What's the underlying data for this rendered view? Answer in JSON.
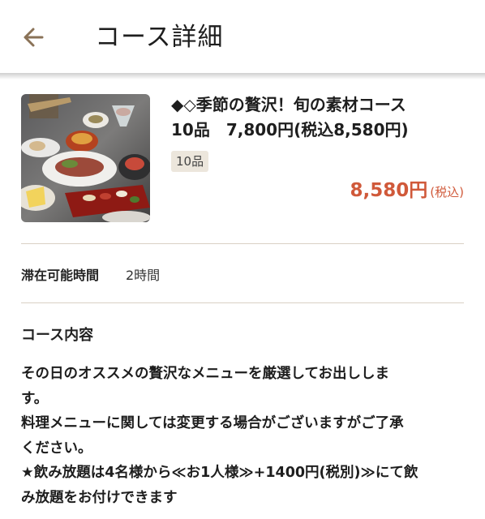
{
  "header": {
    "title": "コース詳細",
    "back_icon": "arrow-left-icon",
    "back_icon_color": "#8a7257"
  },
  "course": {
    "name_lines": [
      "◆◇季節の贅沢！旬の素材コース",
      "10品　7,800円(税込8,580円)"
    ],
    "item_count_badge": "10品",
    "price": "8,580円",
    "price_tax_note": "(税込)",
    "price_color": "#d0593a",
    "photo": "food-course-photo"
  },
  "stay": {
    "label": "滞在可能時間",
    "value": "2時間"
  },
  "content": {
    "title": "コース内容",
    "lines": [
      "その日のオススメの贅沢なメニューを厳選してお出ししま",
      "す。",
      "料理メニューに関しては変更する場合がございますがご了承",
      "ください。",
      "★飲み放題は4名様から≪お1人様≫+1400円(税別)≫にて飲",
      "み放題をお付けできます"
    ]
  }
}
